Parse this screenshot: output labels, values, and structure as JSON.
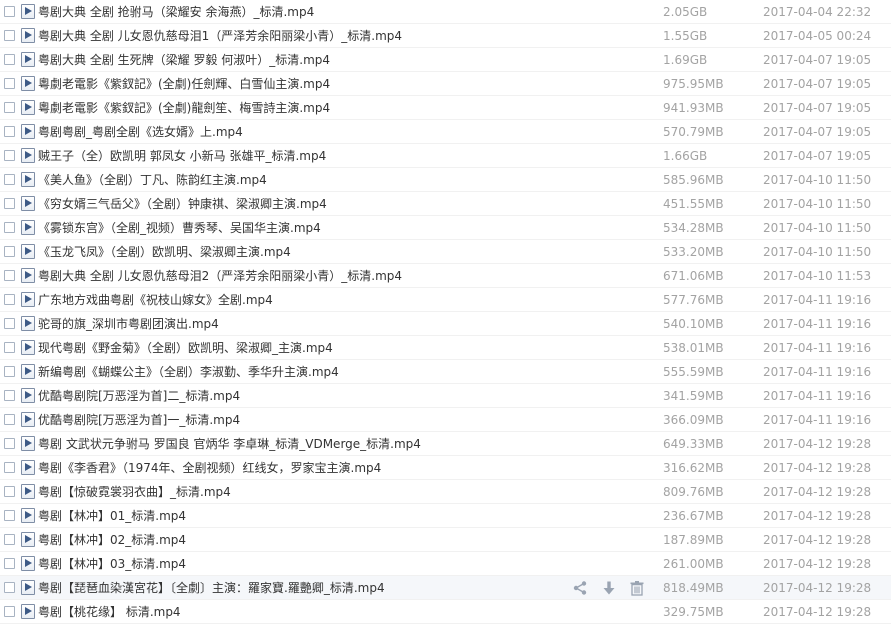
{
  "colors": {
    "name_text": "#333333",
    "meta_text": "#a3a3a3",
    "row_divider": "#f1f1f1",
    "hover_row": "#f5f7fa",
    "icon_accent": "#3d5a86",
    "action_icon": "#9aa4b2"
  },
  "actions": [
    "share-icon",
    "download-icon",
    "delete-icon"
  ],
  "files": [
    {
      "name": "粤剧大典  全剧  抢驸马（梁耀安 余海燕）_标清.mp4",
      "size": "2.05GB",
      "date": "2017-04-04 22:32"
    },
    {
      "name": "粤剧大典  全剧 儿女恩仇慈母泪1（严泽芳余阳丽梁小青）_标清.mp4",
      "size": "1.55GB",
      "date": "2017-04-05 00:24"
    },
    {
      "name": "粤剧大典  全剧  生死牌（梁耀 罗毅 何淑叶）_标清.mp4",
      "size": "1.69GB",
      "date": "2017-04-07 19:05"
    },
    {
      "name": "粵劇老電影《紫釵記》(全劇)任劍輝、白雪仙主演.mp4",
      "size": "975.95MB",
      "date": "2017-04-07 19:05"
    },
    {
      "name": "粵劇老電影《紫釵記》(全劇)龍劍笙、梅雪詩主演.mp4",
      "size": "941.93MB",
      "date": "2017-04-07 19:05"
    },
    {
      "name": "粤剧粤剧_粤剧全剧《选女婿》上.mp4",
      "size": "570.79MB",
      "date": "2017-04-07 19:05"
    },
    {
      "name": "贼王子（全）欧凯明 郭凤女 小新马 张雄平_标清.mp4",
      "size": "1.66GB",
      "date": "2017-04-07 19:05"
    },
    {
      "name": "《美人鱼》（全剧）丁凡、陈韵红主演.mp4",
      "size": "585.96MB",
      "date": "2017-04-10 11:50"
    },
    {
      "name": "《穷女婿三气岳父》（全剧）钟康祺、梁淑卿主演.mp4",
      "size": "451.55MB",
      "date": "2017-04-10 11:50"
    },
    {
      "name": "《雾锁东宫》（全剧_视频）曹秀琴、吴国华主演.mp4",
      "size": "534.28MB",
      "date": "2017-04-10 11:50"
    },
    {
      "name": "《玉龙飞凤》（全剧）欧凯明、梁淑卿主演.mp4",
      "size": "533.20MB",
      "date": "2017-04-10 11:50"
    },
    {
      "name": "粤剧大典  全剧 儿女恩仇慈母泪2（严泽芳余阳丽梁小青）_标清.mp4",
      "size": "671.06MB",
      "date": "2017-04-10 11:53"
    },
    {
      "name": "广东地方戏曲粤剧《祝枝山嫁女》全剧.mp4",
      "size": "577.76MB",
      "date": "2017-04-11 19:16"
    },
    {
      "name": "驼哥的旗_深圳市粤剧团演出.mp4",
      "size": "540.10MB",
      "date": "2017-04-11 19:16"
    },
    {
      "name": "现代粤剧《野金菊》（全剧）欧凯明、梁淑卿_主演.mp4",
      "size": "538.01MB",
      "date": "2017-04-11 19:16"
    },
    {
      "name": "新编粤剧《蝴蝶公主》（全剧）李淑勤、季华升主演.mp4",
      "size": "555.59MB",
      "date": "2017-04-11 19:16"
    },
    {
      "name": "优酷粤剧院[万恶淫为首]二_标清.mp4",
      "size": "341.59MB",
      "date": "2017-04-11 19:16"
    },
    {
      "name": "优酷粤剧院[万恶淫为首]一_标清.mp4",
      "size": "366.09MB",
      "date": "2017-04-11 19:16"
    },
    {
      "name": "粤剧 文武状元争驸马  罗国良 官炳华 李卓琳_标清_VDMerge_标清.mp4",
      "size": "649.33MB",
      "date": "2017-04-12 19:28"
    },
    {
      "name": "粤剧《李香君》（1974年、全剧视频）红线女，罗家宝主演.mp4",
      "size": "316.62MB",
      "date": "2017-04-12 19:28"
    },
    {
      "name": "粤剧【惊破霓裳羽衣曲】_标清.mp4",
      "size": "809.76MB",
      "date": "2017-04-12 19:28"
    },
    {
      "name": "粤剧【林冲】01_标清.mp4",
      "size": "236.67MB",
      "date": "2017-04-12 19:28"
    },
    {
      "name": "粤剧【林冲】02_标清.mp4",
      "size": "187.89MB",
      "date": "2017-04-12 19:28"
    },
    {
      "name": "粤剧【林冲】03_标清.mp4",
      "size": "261.00MB",
      "date": "2017-04-12 19:28"
    },
    {
      "name": "粤剧【琵琶血染漢宮花】〔全劇〕主演：羅家寶.羅艷卿_标清.mp4",
      "size": "818.49MB",
      "date": "2017-04-12 19:28",
      "hover": true
    },
    {
      "name": "粤剧【桃花缘】 标清.mp4",
      "size": "329.75MB",
      "date": "2017-04-12 19:28"
    }
  ]
}
